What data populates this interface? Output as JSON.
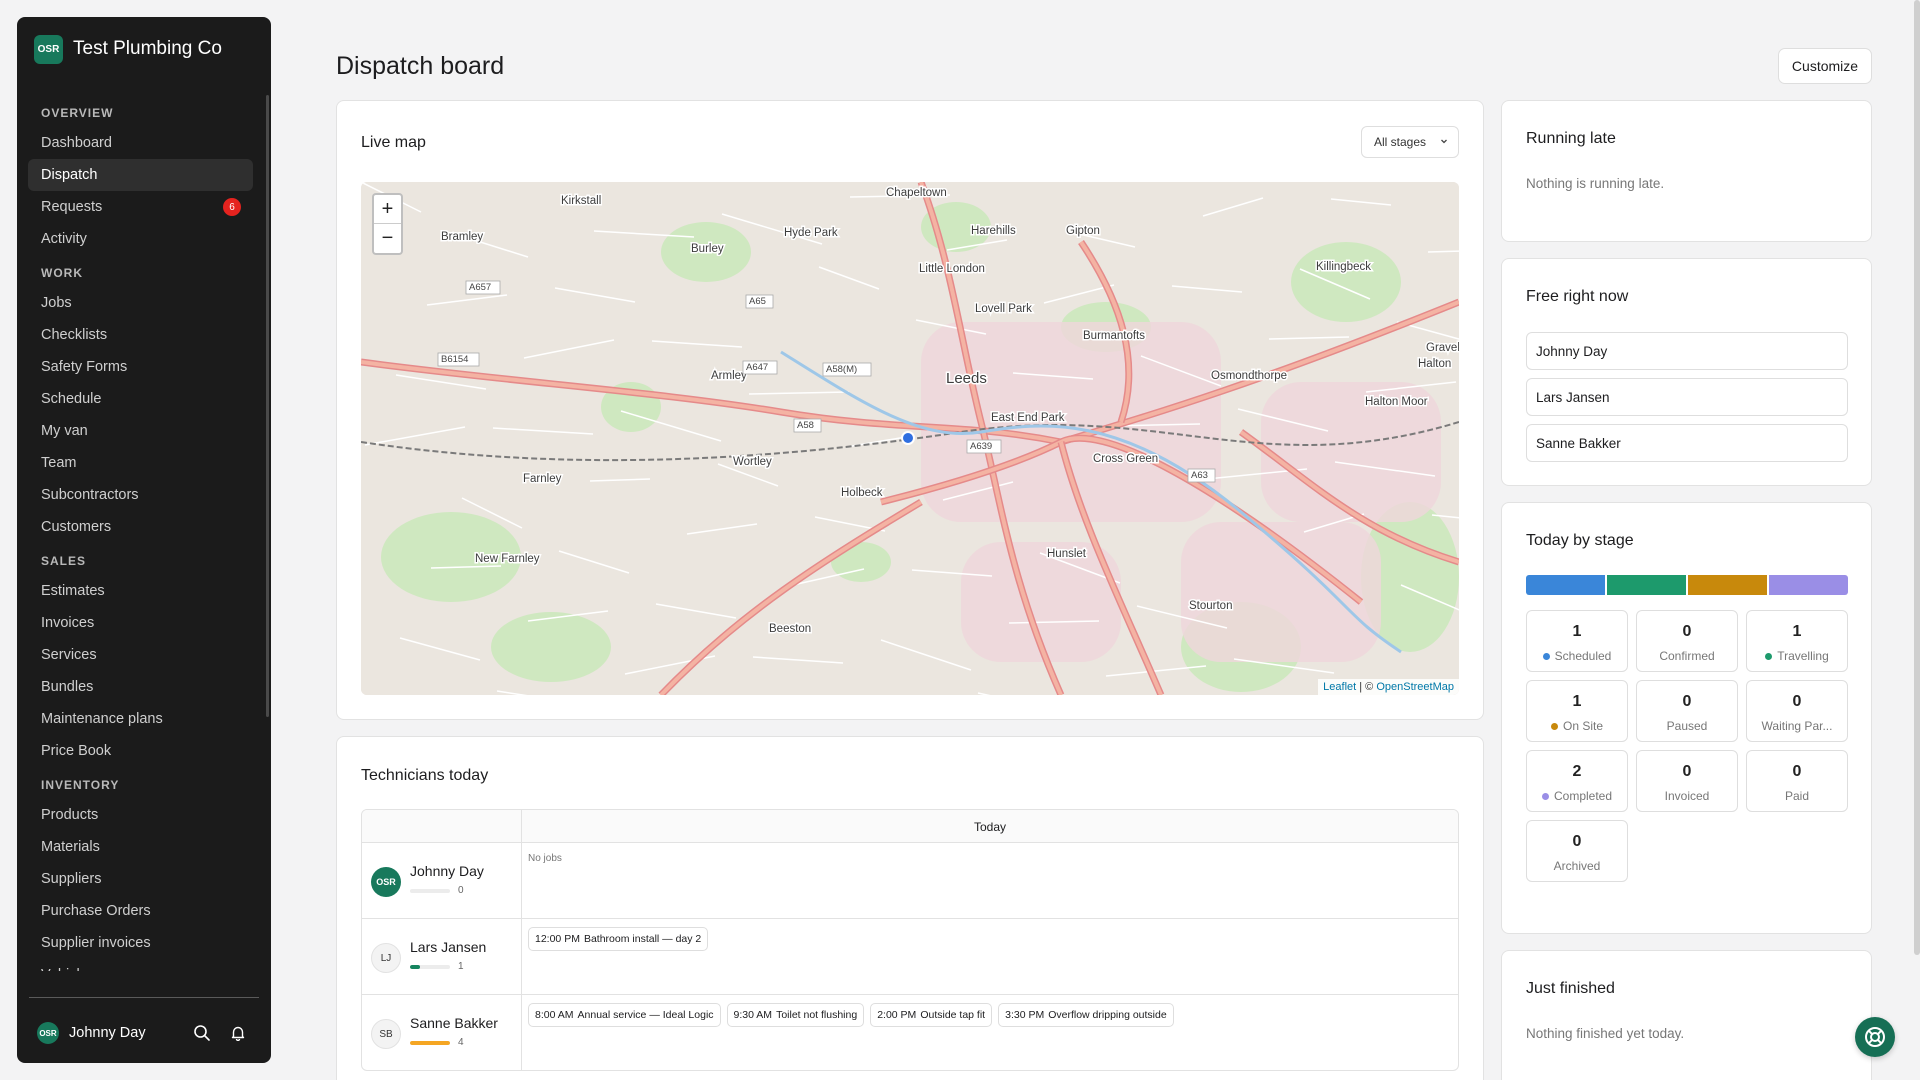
{
  "brand": {
    "logo": "OSR",
    "name": "Test Plumbing Co"
  },
  "sidebar": {
    "sections": [
      {
        "title": "OVERVIEW",
        "items": [
          {
            "label": "Dashboard"
          },
          {
            "label": "Dispatch",
            "active": true
          },
          {
            "label": "Requests",
            "badge": "6"
          },
          {
            "label": "Activity"
          }
        ]
      },
      {
        "title": "WORK",
        "items": [
          {
            "label": "Jobs"
          },
          {
            "label": "Checklists"
          },
          {
            "label": "Safety Forms"
          },
          {
            "label": "Schedule"
          },
          {
            "label": "My van"
          },
          {
            "label": "Team"
          },
          {
            "label": "Subcontractors"
          },
          {
            "label": "Customers"
          }
        ]
      },
      {
        "title": "SALES",
        "items": [
          {
            "label": "Estimates"
          },
          {
            "label": "Invoices"
          },
          {
            "label": "Services"
          },
          {
            "label": "Bundles"
          },
          {
            "label": "Maintenance plans"
          },
          {
            "label": "Price Book"
          }
        ]
      },
      {
        "title": "INVENTORY",
        "items": [
          {
            "label": "Products"
          },
          {
            "label": "Materials"
          },
          {
            "label": "Suppliers"
          },
          {
            "label": "Purchase Orders"
          },
          {
            "label": "Supplier invoices"
          },
          {
            "label": "Vehicles"
          }
        ]
      }
    ],
    "user": {
      "logo": "OSR",
      "name": "Johnny Day",
      "icons": [
        "search-icon",
        "bell-icon"
      ]
    }
  },
  "header": {
    "title": "Dispatch board",
    "customize_label": "Customize"
  },
  "map": {
    "title": "Live map",
    "filter_value": "All stages",
    "zoom_in": "+",
    "zoom_out": "−",
    "attribution_leaflet": "Leaflet",
    "attribution_osm": "OpenStreetMap",
    "places": [
      "Kirkstall",
      "Chapeltown",
      "Harehills",
      "Gipton",
      "Bramley",
      "Burley",
      "Hyde Park",
      "Little London",
      "Killingbeck",
      "Lovell Park",
      "Burmantofts",
      "Armley",
      "Leeds",
      "Osmondthorpe",
      "Halton",
      "Halton Moor",
      "East End Park",
      "Graveleythorpe",
      "Wortley",
      "Cross Green",
      "Farnley",
      "Holbeck",
      "Hunslet",
      "New Farnley",
      "Stourton",
      "Beeston"
    ],
    "road_labels": [
      "A657",
      "B6154",
      "A65",
      "A647",
      "A58(M)",
      "A58",
      "A639",
      "A63"
    ]
  },
  "technicians": {
    "title": "Technicians today",
    "column": "Today",
    "no_jobs": "No jobs",
    "rows": [
      {
        "avatar": "OSR",
        "name": "Johnny Day",
        "count": "0",
        "progress": 0,
        "jobs": []
      },
      {
        "avatar": "LJ",
        "name": "Lars Jansen",
        "count": "1",
        "progress": 0.25,
        "color": "#16855f",
        "jobs": [
          {
            "time": "12:00 PM",
            "title": "Bathroom install — day 2"
          }
        ]
      },
      {
        "avatar": "SB",
        "name": "Sanne Bakker",
        "count": "4",
        "progress": 1,
        "color": "#f5a623",
        "jobs": [
          {
            "time": "8:00 AM",
            "title": "Annual service — Ideal Logic"
          },
          {
            "time": "9:30 AM",
            "title": "Toilet not flushing"
          },
          {
            "time": "2:00 PM",
            "title": "Outside tap fit"
          },
          {
            "time": "3:30 PM",
            "title": "Overflow dripping outside"
          }
        ]
      }
    ]
  },
  "running_late": {
    "title": "Running late",
    "empty": "Nothing is running late."
  },
  "free_now": {
    "title": "Free right now",
    "people": [
      "Johnny Day",
      "Lars Jansen",
      "Sanne Bakker"
    ]
  },
  "today_by_stage": {
    "title": "Today by stage",
    "bar_colors": [
      "#3a86d9",
      "#1d9a6c",
      "#c8890c",
      "#9a8ee6"
    ],
    "stages": [
      {
        "count": "1",
        "label": "Scheduled",
        "dot": "#3a86d9"
      },
      {
        "count": "0",
        "label": "Confirmed"
      },
      {
        "count": "1",
        "label": "Travelling",
        "dot": "#1d9a6c"
      },
      {
        "count": "1",
        "label": "On Site",
        "dot": "#c8890c"
      },
      {
        "count": "0",
        "label": "Paused"
      },
      {
        "count": "0",
        "label": "Waiting Par..."
      },
      {
        "count": "2",
        "label": "Completed",
        "dot": "#9a8ee6"
      },
      {
        "count": "0",
        "label": "Invoiced"
      },
      {
        "count": "0",
        "label": "Paid"
      },
      {
        "count": "0",
        "label": "Archived"
      }
    ]
  },
  "just_finished": {
    "title": "Just finished",
    "empty": "Nothing finished yet today."
  }
}
